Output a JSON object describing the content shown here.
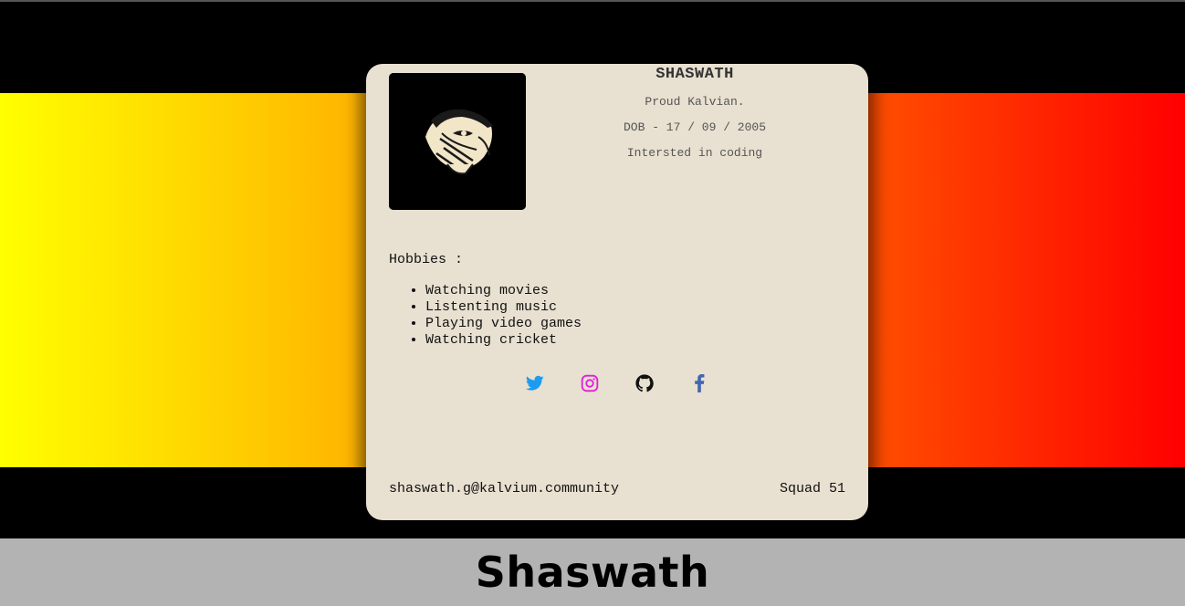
{
  "profile": {
    "name": "SHASWATH",
    "line1": "Proud Kalvian.",
    "line2": "DOB - 17 / 09 / 2005",
    "line3": "Intersted in coding"
  },
  "hobbies": {
    "title": "Hobbies :",
    "items": [
      "Watching movies",
      "Listenting music",
      "Playing video games",
      "Watching cricket"
    ]
  },
  "socials": [
    {
      "icon": "twitter-icon",
      "color": "#1d9bf0"
    },
    {
      "icon": "instagram-icon",
      "color": "#e1306c"
    },
    {
      "icon": "github-icon",
      "color": "#111111"
    },
    {
      "icon": "facebook-icon",
      "color": "#4267b2"
    }
  ],
  "contact": {
    "email": "shaswath.g@kalvium.community",
    "squad": "Squad 51"
  },
  "footer": {
    "name": "Shaswath"
  },
  "colors": {
    "card_bg": "#e8e0d0",
    "gradient_start": "#ffff00",
    "gradient_end": "#ff0000",
    "footer_bg": "#b3b3b3"
  }
}
